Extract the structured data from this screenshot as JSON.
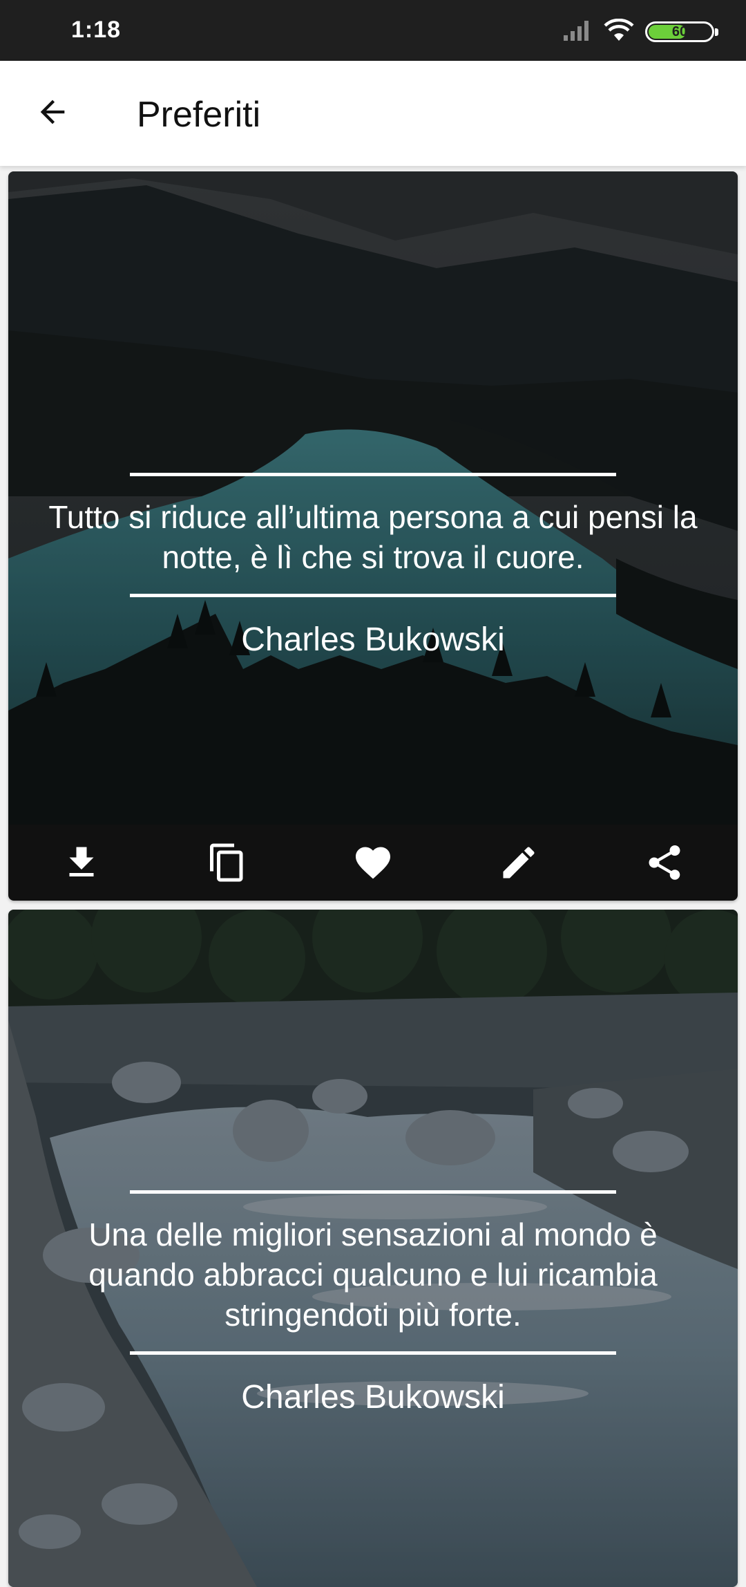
{
  "status_bar": {
    "time": "1:18",
    "battery_level": "60",
    "battery_color": "#6ccf3a",
    "icons": [
      "signal-icon",
      "wifi-icon",
      "battery-icon"
    ]
  },
  "app_bar": {
    "back_icon": "arrow-back-icon",
    "title": "Preferiti"
  },
  "cards": [
    {
      "quote": "Tutto si riduce all’ultima persona a cui pensi la notte, è lì che si trova il cuore.",
      "author": "Charles Bukowski",
      "background": "mountain-lake-photo",
      "actions": [
        "download-icon",
        "copy-icon",
        "heart-icon",
        "edit-icon",
        "share-icon"
      ]
    },
    {
      "quote": "Una delle migliori sensazioni al mondo è quando abbracci qualcuno e lui ricambia stringendoti più forte.",
      "author": "Charles Bukowski",
      "background": "rocky-river-photo"
    }
  ],
  "colors": {
    "status_bar": "#1f1f1f",
    "app_bar": "#ffffff",
    "action_bar": "#111111",
    "text_on_image": "#ffffff"
  }
}
